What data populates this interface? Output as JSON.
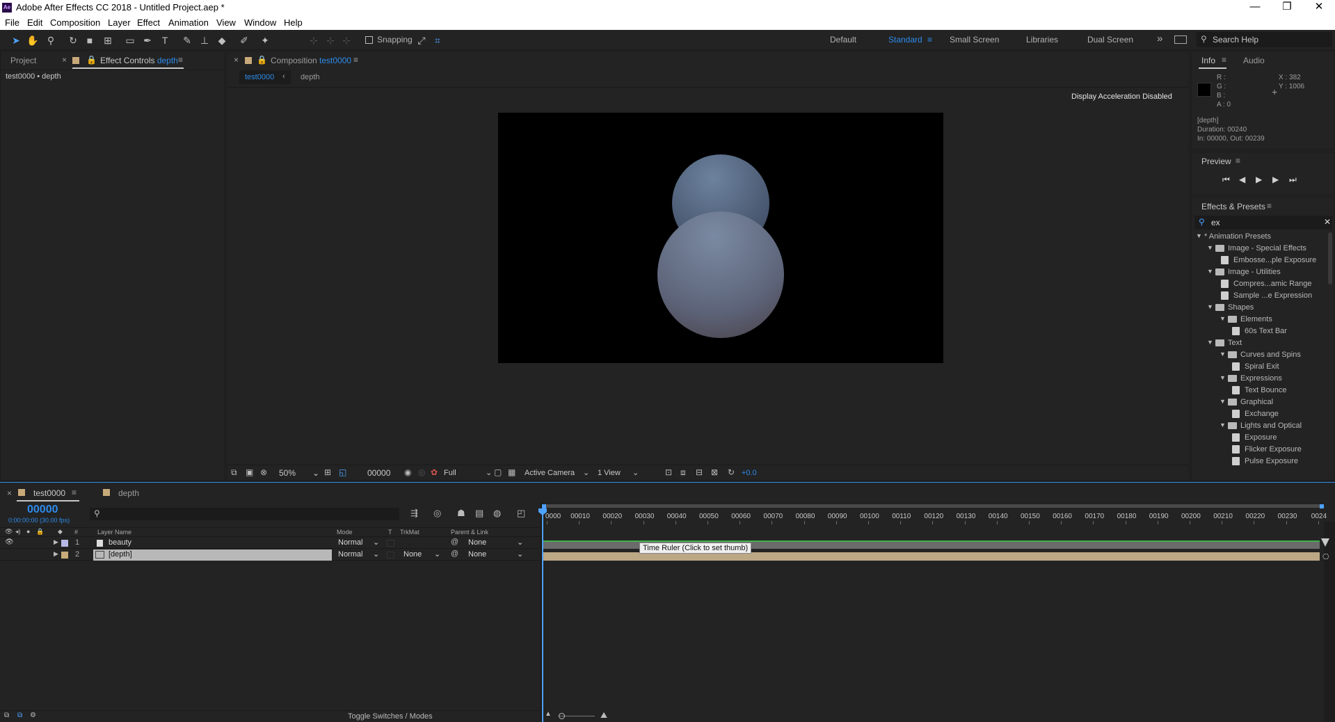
{
  "app": {
    "title": "Adobe After Effects CC 2018 - Untitled Project.aep *",
    "icon": "Ae",
    "window_controls": [
      "—",
      "❐",
      "✕"
    ]
  },
  "menu": [
    "File",
    "Edit",
    "Composition",
    "Layer",
    "Effect",
    "Animation",
    "View",
    "Window",
    "Help"
  ],
  "toolbar": {
    "snapping": "Snapping",
    "workspaces": [
      "Default",
      "Standard",
      "Small Screen",
      "Libraries",
      "Dual Screen"
    ],
    "active_workspace": "Standard",
    "overflow": "»",
    "search": "Search Help"
  },
  "left_panel": {
    "tab_project": "Project",
    "tab_effect_controls": "Effect Controls",
    "effect_target": "depth",
    "breadcrumb": "test0000 • depth"
  },
  "comp_panel": {
    "tab_label": "Composition",
    "comp_name": "test0000",
    "nav_active": "test0000",
    "nav_layer": "depth",
    "notice": "Display Acceleration Disabled",
    "footer": {
      "zoom": "50%",
      "timecode": "00000",
      "resolution": "Full",
      "camera": "Active Camera",
      "views": "1 View",
      "exposure": "+0.0"
    }
  },
  "info": {
    "tab_info": "Info",
    "tab_audio": "Audio",
    "r": "R :",
    "g": "G :",
    "b": "B :",
    "a": "A :  0",
    "x": "X : 382",
    "y": "Y : 1006",
    "layer": "[depth]",
    "duration": "Duration: 00240",
    "inout": "In: 00000, Out: 00239"
  },
  "preview": {
    "title": "Preview"
  },
  "effects_presets": {
    "title": "Effects & Presets",
    "search": "ex",
    "tree": [
      {
        "label": "* Animation Presets",
        "level": 0,
        "kind": "root"
      },
      {
        "label": "Image - Special Effects",
        "level": 1,
        "kind": "folder"
      },
      {
        "label": "Embosse...ple Exposure",
        "level": 2,
        "kind": "fx"
      },
      {
        "label": "Image - Utilities",
        "level": 1,
        "kind": "folder"
      },
      {
        "label": "Compres...amic Range",
        "level": 2,
        "kind": "fx"
      },
      {
        "label": "Sample ...e Expression",
        "level": 2,
        "kind": "fx"
      },
      {
        "label": "Shapes",
        "level": 1,
        "kind": "folder"
      },
      {
        "label": "Elements",
        "level": 2,
        "kind": "folder"
      },
      {
        "label": "60s Text Bar",
        "level": 3,
        "kind": "fx"
      },
      {
        "label": "Text",
        "level": 1,
        "kind": "folder"
      },
      {
        "label": "Curves and Spins",
        "level": 2,
        "kind": "folder"
      },
      {
        "label": "Spiral Exit",
        "level": 3,
        "kind": "fx"
      },
      {
        "label": "Expressions",
        "level": 2,
        "kind": "folder"
      },
      {
        "label": "Text Bounce",
        "level": 3,
        "kind": "fx"
      },
      {
        "label": "Graphical",
        "level": 2,
        "kind": "folder"
      },
      {
        "label": "Exchange",
        "level": 3,
        "kind": "fx"
      },
      {
        "label": "Lights and Optical",
        "level": 2,
        "kind": "folder"
      },
      {
        "label": "Exposure",
        "level": 3,
        "kind": "fx"
      },
      {
        "label": "Flicker Exposure",
        "level": 3,
        "kind": "fx"
      },
      {
        "label": "Pulse Exposure",
        "level": 3,
        "kind": "fx"
      }
    ]
  },
  "timeline": {
    "tab_active": "test0000",
    "tab_other": "depth",
    "timecode": "00000",
    "timecode_sub": "0:00:00:00 (30.00 fps)",
    "columns": {
      "num": "#",
      "layer_name": "Layer Name",
      "mode": "Mode",
      "t": "T",
      "trkmat": "TrkMat",
      "parent": "Parent & Link"
    },
    "layers": [
      {
        "num": "1",
        "name": "beauty",
        "mode": "Normal",
        "trkmat": "",
        "parent": "None",
        "color": "#b7b7e6"
      },
      {
        "num": "2",
        "name": "[depth]",
        "mode": "Normal",
        "trkmat": "None",
        "parent": "None",
        "color": "#c8a97a"
      }
    ],
    "ruler": [
      "0000",
      "00010",
      "00020",
      "00030",
      "00040",
      "00050",
      "00060",
      "00070",
      "00080",
      "00090",
      "00100",
      "00110",
      "00120",
      "00130",
      "00140",
      "00150",
      "00160",
      "00170",
      "00180",
      "00190",
      "00200",
      "00210",
      "00220",
      "00230",
      "0024"
    ],
    "tooltip": "Time Ruler (Click to set thumb)",
    "toggle": "Toggle Switches / Modes"
  }
}
